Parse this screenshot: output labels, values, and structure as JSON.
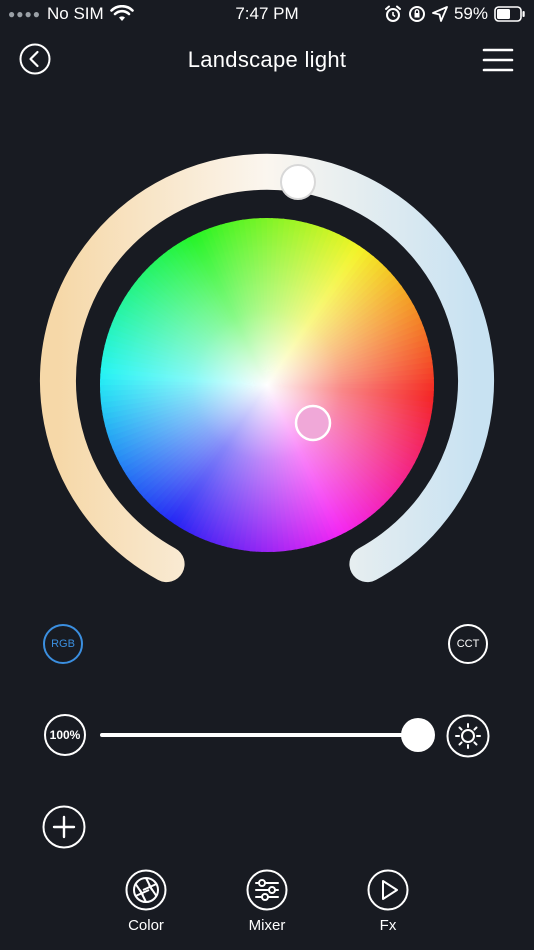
{
  "status_bar": {
    "carrier": "No SIM",
    "time": "7:47 PM",
    "battery_percent": "59%",
    "battery_level": 0.59
  },
  "header": {
    "title": "Landscape light"
  },
  "color_wheel": {
    "selected_color": "#f0a8d8",
    "cct_level": 0.5
  },
  "modes": {
    "rgb_label": "RGB",
    "cct_label": "CCT",
    "active": "RGB",
    "active_color": "#3b8fe0"
  },
  "brightness": {
    "label": "100%",
    "value": 1.0
  },
  "nav": {
    "items": [
      {
        "label": "Color",
        "icon": "aperture-icon"
      },
      {
        "label": "Mixer",
        "icon": "sliders-icon"
      },
      {
        "label": "Fx",
        "icon": "play-icon"
      }
    ]
  }
}
